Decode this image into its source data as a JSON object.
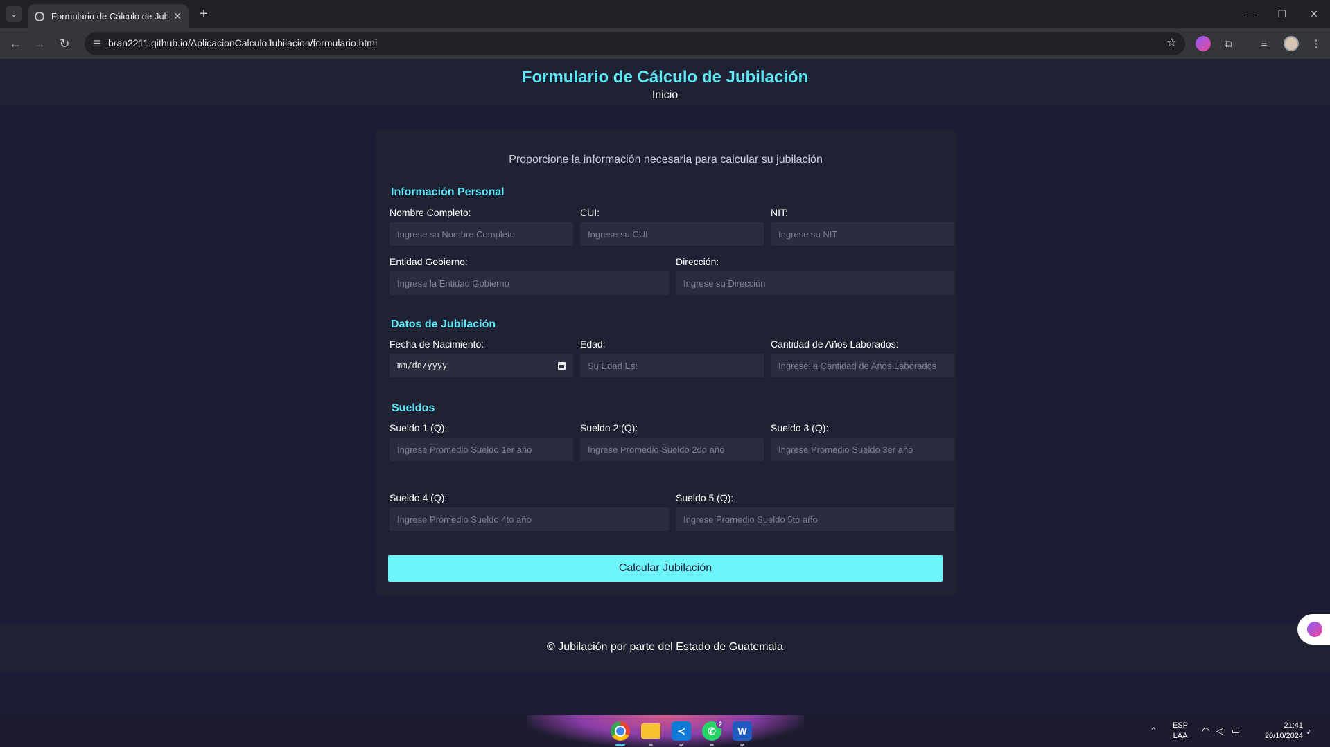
{
  "browser": {
    "tab_title": "Formulario de Cálculo de Jubilación",
    "url": "bran2211.github.io/AplicacionCalculoJubilacion/formulario.html"
  },
  "header": {
    "title": "Formulario de Cálculo de Jubilación",
    "home_link": "Inicio"
  },
  "form": {
    "intro": "Proporcione la información necesaria para calcular su jubilación",
    "personal": {
      "title": "Información Personal",
      "nombre": {
        "label": "Nombre Completo:",
        "placeholder": "Ingrese su Nombre Completo"
      },
      "cui": {
        "label": "CUI:",
        "placeholder": "Ingrese su CUI"
      },
      "nit": {
        "label": "NIT:",
        "placeholder": "Ingrese su NIT"
      },
      "entidad": {
        "label": "Entidad Gobierno:",
        "placeholder": "Ingrese la Entidad Gobierno"
      },
      "direccion": {
        "label": "Dirección:",
        "placeholder": "Ingrese su Dirección"
      }
    },
    "jubilacion": {
      "title": "Datos de Jubilación",
      "fecha": {
        "label": "Fecha de Nacimiento:",
        "value": "mm/dd/yyyy"
      },
      "edad": {
        "label": "Edad:",
        "placeholder": "Su Edad Es:"
      },
      "anios": {
        "label": "Cantidad de Años Laborados:",
        "placeholder": "Ingrese la Cantidad de Años Laborados"
      }
    },
    "sueldos": {
      "title": "Sueldos",
      "s1": {
        "label": "Sueldo 1 (Q):",
        "placeholder": "Ingrese Promedio Sueldo 1er año"
      },
      "s2": {
        "label": "Sueldo 2 (Q):",
        "placeholder": "Ingrese Promedio Sueldo 2do año"
      },
      "s3": {
        "label": "Sueldo 3 (Q):",
        "placeholder": "Ingrese Promedio Sueldo 3er año"
      },
      "s4": {
        "label": "Sueldo 4 (Q):",
        "placeholder": "Ingrese Promedio Sueldo 4to año"
      },
      "s5": {
        "label": "Sueldo 5 (Q):",
        "placeholder": "Ingrese Promedio Sueldo 5to año"
      }
    },
    "submit_label": "Calcular Jubilación"
  },
  "footer": {
    "text": "© Jubilación por parte del Estado de Guatemala"
  },
  "taskbar": {
    "whatsapp_badge": "2",
    "lang_line1": "ESP",
    "lang_line2": "LAA",
    "time": "21:41",
    "date": "20/10/2024"
  },
  "colors": {
    "accent": "#5ee7f7",
    "button": "#6df3fb",
    "page_bg": "#1b1d35",
    "card_bg": "#1f2233"
  }
}
